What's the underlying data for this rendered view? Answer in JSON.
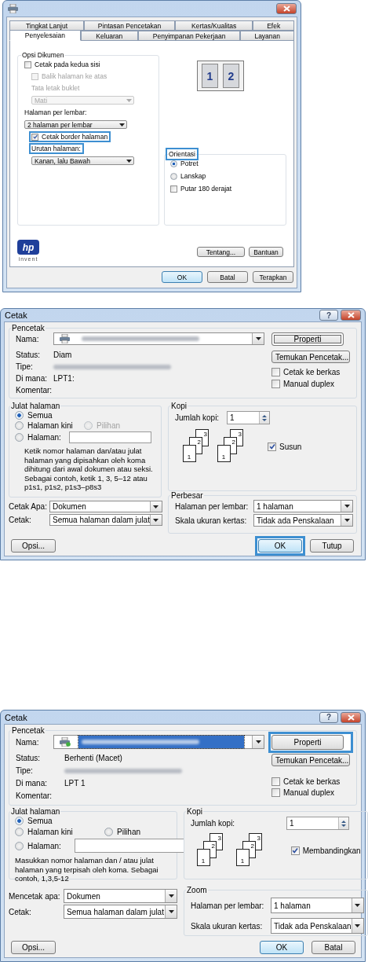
{
  "driver_dialog": {
    "tabs_row_1": [
      {
        "label": "Tingkat Lanjut",
        "selected": false
      },
      {
        "label": "Pintasan Pencetakan",
        "selected": false
      },
      {
        "label": "Kertas/Kualitas",
        "selected": false
      },
      {
        "label": "Efek",
        "selected": false
      }
    ],
    "tabs_row_2": [
      {
        "label": "Penyelesaian",
        "selected": true
      },
      {
        "label": "Keluaran",
        "selected": false
      },
      {
        "label": "Penyimpanan Pekerjaan",
        "selected": false
      },
      {
        "label": "Layanan",
        "selected": false
      }
    ],
    "document_options": {
      "title": "Opsi Dikumen",
      "items": [
        {
          "kind": "checkbox",
          "label": "Cetak pada kedua sisi",
          "checked": false,
          "disabled": false,
          "highlighted": false,
          "children": [
            {
              "kind": "checkbox",
              "label": "Balik halaman ke atas",
              "checked": false,
              "disabled": true,
              "highlighted": false
            },
            {
              "kind": "label",
              "label": "Tata letak buklet",
              "disabled": true,
              "highlighted": false
            },
            {
              "kind": "select",
              "value": "Mati",
              "disabled": true,
              "highlighted": false
            }
          ]
        },
        {
          "kind": "label",
          "label": "Halaman per lembar:",
          "disabled": false,
          "highlighted": false
        },
        {
          "kind": "select",
          "value": "2 halaman per lembar",
          "disabled": false,
          "highlighted": false,
          "children": [
            {
              "kind": "checkbox",
              "label": "Cetak border halaman",
              "checked": true,
              "disabled": false,
              "highlighted": true
            },
            {
              "kind": "label",
              "label": "Urutan halaman:",
              "disabled": false,
              "highlighted": true
            },
            {
              "kind": "select",
              "value": "Kanan, lalu Bawah",
              "disabled": false,
              "highlighted": false
            }
          ]
        }
      ]
    },
    "preview": {
      "pages": [
        "1",
        "2"
      ]
    },
    "orientation": {
      "title": "Orientasi",
      "title_highlighted": true,
      "options": [
        {
          "kind": "radio",
          "label": "Potret",
          "selected": true
        },
        {
          "kind": "radio",
          "label": "Lanskap",
          "selected": false
        },
        {
          "kind": "checkbox",
          "label": "Putar 180 derajat",
          "checked": false
        }
      ]
    },
    "logo": {
      "mark": "hp",
      "caption": "invent"
    },
    "side_buttons": [
      "Tentang...",
      "Bantuan"
    ],
    "buttons": [
      {
        "label": "OK",
        "default": true
      },
      {
        "label": "Batal",
        "default": false
      },
      {
        "label": "Terapkan",
        "default": false
      }
    ]
  },
  "print_dialogs": [
    {
      "title": "Cetak",
      "help_glyph": "?",
      "printer": {
        "title": "Pencetak",
        "name_label": "Nama:",
        "name_selected": false,
        "fields": [
          {
            "label": "Status:",
            "kind": "text",
            "value": "Diam"
          },
          {
            "label": "Tipe:",
            "kind": "blurred"
          },
          {
            "label": "Di mana:",
            "kind": "text",
            "value": "LPT1:"
          },
          {
            "label": "Komentar:",
            "kind": "empty"
          }
        ],
        "buttons": [
          {
            "label": "Properti",
            "focused": true,
            "highlighted": false
          },
          {
            "label": "Temukan Pencetak...",
            "focused": false,
            "highlighted": false
          }
        ],
        "checkboxes": [
          {
            "label": "Cetak ke berkas",
            "checked": false
          },
          {
            "label": "Manual duplex",
            "checked": false
          }
        ]
      },
      "range": {
        "title": "Julat halaman",
        "rows": [
          {
            "options": [
              {
                "label": "Semua",
                "selected": true,
                "disabled": false
              }
            ]
          },
          {
            "options": [
              {
                "label": "Halaman kini",
                "selected": false,
                "disabled": false
              },
              {
                "label": "Pilihan",
                "selected": false,
                "disabled": true
              }
            ]
          },
          {
            "options": [
              {
                "label": "Halaman:",
                "selected": false,
                "disabled": false,
                "has_input": true
              }
            ]
          }
        ],
        "hint": "Ketik nomor halaman dan/atau julat halaman yang dipisahkan oleh koma dihitung dari awal dokumen atau seksi. Sebagai contoh, ketik 1, 3, 5–12 atau p1s1, p1s2, p1s3–p8s3"
      },
      "copies": {
        "title": "Kopi",
        "label": "Jumlah kopi:",
        "value": "1",
        "collate_stacks": [
          [
            "1",
            "2",
            "3"
          ],
          [
            "1",
            "2",
            "3"
          ]
        ],
        "collate": {
          "label": "Susun",
          "checked": true
        }
      },
      "what": [
        {
          "label": "Cetak Apa:",
          "value": "Dokumen"
        },
        {
          "label": "Cetak:",
          "value": "Semua halaman dalam julat"
        }
      ],
      "zoom": {
        "title": "Perbesar",
        "rows": [
          {
            "label": "Halaman per lembar:",
            "value": "1 halaman"
          },
          {
            "label": "Skala ukuran kertas:",
            "value": "Tidak ada Penskalaan"
          }
        ]
      },
      "options_button": "Opsi...",
      "buttons": [
        {
          "label": "OK",
          "default": true,
          "highlighted": true
        },
        {
          "label": "Tutup",
          "default": false,
          "highlighted": false
        }
      ]
    },
    {
      "title": "Cetak",
      "help_glyph": "?",
      "printer": {
        "title": "Pencetak",
        "name_label": "Nama:",
        "name_selected": true,
        "fields": [
          {
            "label": "Status:",
            "kind": "text",
            "value": "Berhenti (Macet)"
          },
          {
            "label": "Tipe:",
            "kind": "blurred"
          },
          {
            "label": "Di mana:",
            "kind": "text",
            "value": "LPT 1"
          },
          {
            "label": "Komentar:",
            "kind": "empty"
          }
        ],
        "buttons": [
          {
            "label": "Properti",
            "focused": false,
            "highlighted": true
          },
          {
            "label": "Temukan Pencetak...",
            "focused": false,
            "highlighted": false
          }
        ],
        "checkboxes": [
          {
            "label": "Cetak ke berkas",
            "checked": false
          },
          {
            "label": "Manual duplex",
            "checked": false
          }
        ]
      },
      "range": {
        "title": "Julat halaman",
        "rows": [
          {
            "options": [
              {
                "label": "Semua",
                "selected": true,
                "disabled": false
              }
            ]
          },
          {
            "options": [
              {
                "label": "Halaman kini",
                "selected": false,
                "disabled": false
              },
              {
                "label": "Pilihan",
                "selected": false,
                "disabled": false
              }
            ]
          },
          {
            "options": [
              {
                "label": "Halaman:",
                "selected": false,
                "disabled": false,
                "has_input": true
              }
            ]
          }
        ],
        "hint": "Masukkan nomor halaman dan / atau julat halaman yang terpisah oleh koma. Sebagai contoh, 1,3,5-12"
      },
      "copies": {
        "title": "Kopi",
        "label": "Jumlah kopi:",
        "value": "1",
        "collate_stacks": [
          [
            "1",
            "2",
            "3"
          ],
          [
            "1",
            "2",
            "3"
          ]
        ],
        "collate": {
          "label": "Membandingkan",
          "checked": true
        }
      },
      "what": [
        {
          "label": "Mencetak apa:",
          "value": "Dokumen"
        },
        {
          "label": "Cetak:",
          "value": "Semua halaman dalam julat"
        }
      ],
      "zoom": {
        "title": "Zoom",
        "rows": [
          {
            "label": "Halaman per lembar:",
            "value": "1 halaman"
          },
          {
            "label": "Skala ukuran kertas:",
            "value": "Tidak ada Penskalaan"
          }
        ]
      },
      "options_button": "Opsi...",
      "buttons": [
        {
          "label": "OK",
          "default": true,
          "highlighted": false
        },
        {
          "label": "Batal",
          "default": false,
          "highlighted": false
        }
      ]
    }
  ]
}
